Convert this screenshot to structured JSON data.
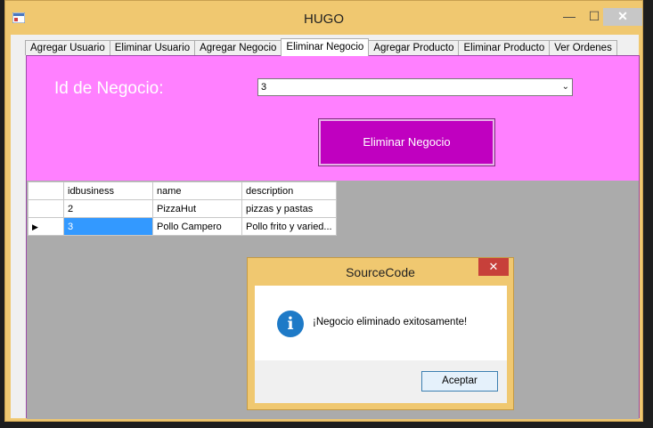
{
  "window": {
    "title": "HUGO"
  },
  "tabs": [
    {
      "label": "Agregar Usuario"
    },
    {
      "label": "Eliminar Usuario"
    },
    {
      "label": "Agregar Negocio"
    },
    {
      "label": "Eliminar Negocio",
      "active": true
    },
    {
      "label": "Agregar Producto"
    },
    {
      "label": "Eliminar Producto"
    },
    {
      "label": "Ver Ordenes"
    }
  ],
  "form": {
    "id_label": "Id de Negocio:",
    "combo_value": "3",
    "delete_button": "Eliminar Negocio",
    "accent_color": "#ff80ff",
    "button_color": "#c000c0"
  },
  "grid": {
    "columns": [
      "idbusiness",
      "name",
      "description"
    ],
    "rows": [
      {
        "idbusiness": "2",
        "name": "PizzaHut",
        "description": "pizzas y pastas"
      },
      {
        "idbusiness": "3",
        "name": "Pollo Campero",
        "description": "Pollo frito y varied..."
      }
    ]
  },
  "dialog": {
    "title": "SourceCode",
    "message": "¡Negocio eliminado exitosamente!",
    "ok_button": "Aceptar",
    "icon": "info-icon"
  }
}
